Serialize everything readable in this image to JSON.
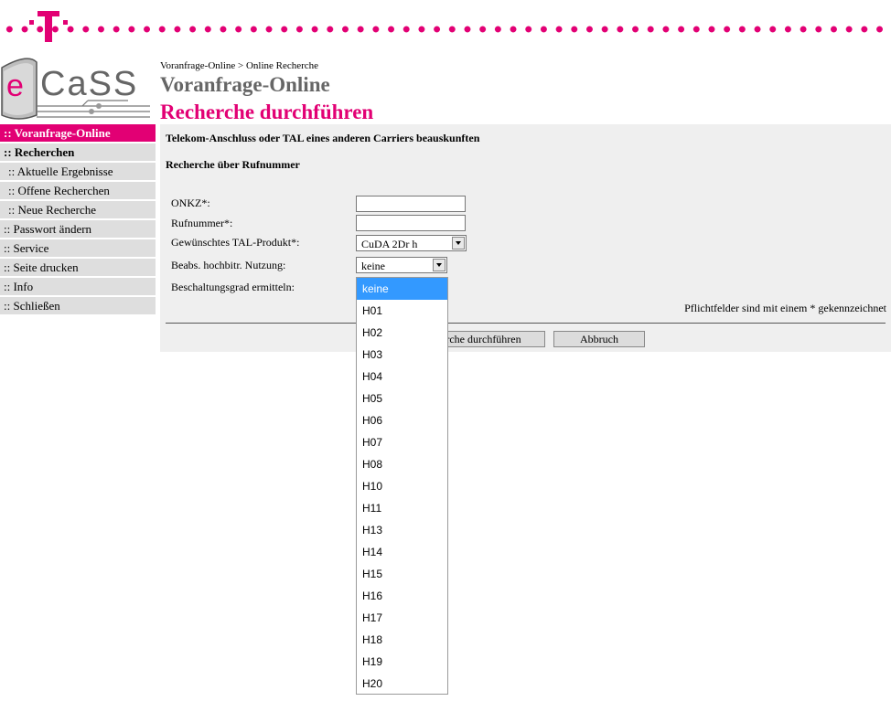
{
  "header": {
    "breadcrumb": "Voranfrage-Online > Online Recherche",
    "app_title": "Voranfrage-Online",
    "page_title": "Recherche durchführen",
    "logo_text_e": "e",
    "logo_text_rest": "CaSS",
    "brand_color": "#e20074"
  },
  "sidebar": {
    "items": [
      {
        "label": ":: Voranfrage-Online",
        "kind": "active"
      },
      {
        "label": ":: Recherchen",
        "kind": "section"
      },
      {
        "label": ":: Aktuelle Ergebnisse",
        "kind": "sub"
      },
      {
        "label": ":: Offene Recherchen",
        "kind": "sub"
      },
      {
        "label": ":: Neue Recherche",
        "kind": "sub"
      },
      {
        "label": ":: Passwort ändern",
        "kind": "normal"
      },
      {
        "label": ":: Service",
        "kind": "normal"
      },
      {
        "label": ":: Seite drucken",
        "kind": "normal"
      },
      {
        "label": ":: Info",
        "kind": "normal"
      },
      {
        "label": ":: Schließen",
        "kind": "normal"
      }
    ]
  },
  "form": {
    "heading": "Telekom-Anschluss oder TAL eines anderen Carriers beauskunften",
    "subheading": "Recherche über Rufnummer",
    "onkz_label": "ONKZ*:",
    "onkz_value": "",
    "rufnummer_label": "Rufnummer*:",
    "rufnummer_value": "",
    "tal_label": "Gewünschtes TAL-Produkt*:",
    "tal_value": "CuDA 2Dr h",
    "nutzung_label": "Beabs. hochbitr. Nutzung:",
    "nutzung_value": "keine",
    "beschaltung_label": "Beschaltungsgrad ermitteln:",
    "required_note": "Pflichtfelder sind mit einem * gekennzeichnet",
    "submit_label": "Recherche durchführen",
    "cancel_label": "Abbruch"
  },
  "dropdown": {
    "selected": "keine",
    "options": [
      "keine",
      "H01",
      "H02",
      "H03",
      "H04",
      "H05",
      "H06",
      "H07",
      "H08",
      "H10",
      "H11",
      "H13",
      "H14",
      "H15",
      "H16",
      "H17",
      "H18",
      "H19",
      "H20"
    ]
  }
}
